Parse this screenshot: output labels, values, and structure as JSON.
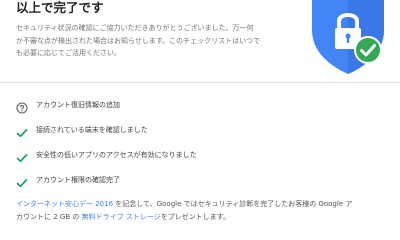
{
  "header": {
    "title": "以上で完了です",
    "intro_lines": [
      "セキュリティ状況の確認にご協力いただきありがとうございました。万一何",
      "か不審な点が検出された場合はお知らせします。このチェックリストはいつで",
      "も必要に応じてご活用ください。"
    ]
  },
  "checklist": {
    "items": [
      {
        "label": "アカウント復旧情報の追加",
        "icon": "help-circle-icon"
      },
      {
        "label": "接続されている端末を確認しました",
        "icon": "check-icon"
      },
      {
        "label": "安全性の低いアプリのアクセスが有効になりました",
        "icon": "check-icon"
      },
      {
        "label": "アカウント権限の確認完了",
        "icon": "check-icon"
      }
    ]
  },
  "footer": {
    "link_internet_day": "インターネット安心デー 2016",
    "text_1": " を記念して、Google ではセキュリティ診断を完了したお客様の Google ア",
    "text_2": "カウントに 2 GB の ",
    "link_free_storage": "無料ドライブ ストレージ",
    "text_3": "をプレゼントします。"
  },
  "colors": {
    "shield_blue": "#4285f4",
    "shield_dark": "#3367d6",
    "check_green": "#34a853",
    "link_blue": "#4285f4",
    "check_icon_green": "#0f9d58"
  }
}
